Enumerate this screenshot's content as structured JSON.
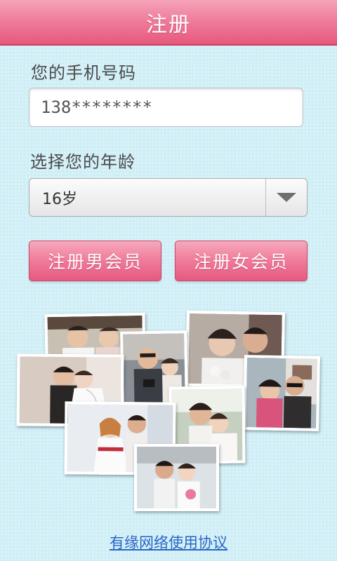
{
  "header": {
    "title": "注册"
  },
  "form": {
    "phone_label": "您的手机号码",
    "phone_value": "138********",
    "age_label": "选择您的年龄",
    "age_selected": "16岁"
  },
  "buttons": {
    "male": "注册男会员",
    "female": "注册女会员"
  },
  "footer": {
    "agreement_link": "有缘网络使用协议"
  },
  "colors": {
    "titlebar": "#ef7e9c",
    "button": "#f07a99",
    "background": "#cfeef6",
    "link": "#2a66c6"
  }
}
